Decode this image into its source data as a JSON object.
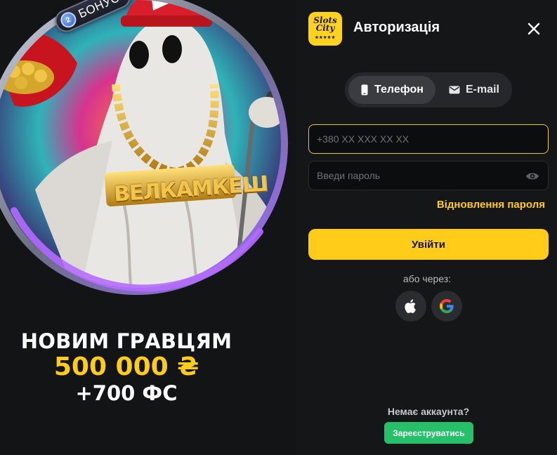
{
  "promo": {
    "badge_text": "БОНУС",
    "badge_coin": "2",
    "chain_text": "ВЕЛКАМКЕШ",
    "line1": "НОВИМ ГРАВЦЯМ",
    "line2": "500 000 ₴",
    "line3": "+700 ФС"
  },
  "header": {
    "logo_line1": "Slots",
    "logo_line2": "City",
    "logo_stars": "★★★★★",
    "title": "Авторизація",
    "close_icon": "close-icon"
  },
  "tabs": [
    {
      "label": "Телефон",
      "icon": "phone-icon",
      "active": true
    },
    {
      "label": "E-mail",
      "icon": "mail-icon",
      "active": false
    }
  ],
  "form": {
    "phone_placeholder": "+380 XX XXX XX XX",
    "password_placeholder": "Введи пароль",
    "forgot_label": "Відновлення пароля",
    "login_label": "Увійти"
  },
  "social": {
    "or_label": "або через:",
    "providers": [
      "apple-icon",
      "google-icon"
    ]
  },
  "footer": {
    "no_account": "Немає аккаунта?",
    "register_label": "Зареєструватись"
  },
  "colors": {
    "accent": "#ffcc1a",
    "register": "#26c06a",
    "background": "#151618"
  }
}
